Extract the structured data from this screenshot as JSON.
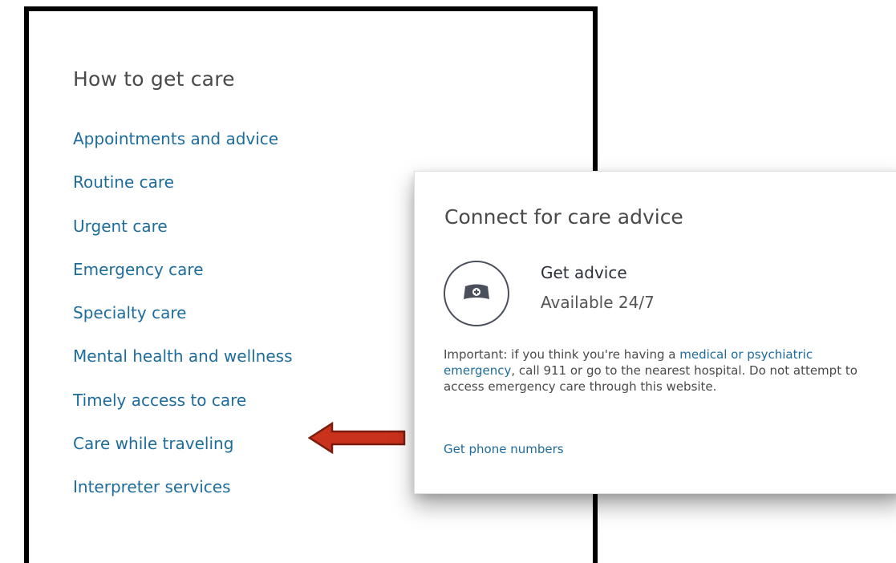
{
  "left_panel": {
    "title": "How to get care",
    "items": [
      {
        "label": "Appointments and advice"
      },
      {
        "label": "Routine care"
      },
      {
        "label": "Urgent care"
      },
      {
        "label": "Emergency care"
      },
      {
        "label": "Specialty care"
      },
      {
        "label": "Mental health and wellness"
      },
      {
        "label": "Timely access to care"
      },
      {
        "label": "Care while traveling"
      },
      {
        "label": "Interpreter services"
      }
    ]
  },
  "annotation": {
    "arrow_icon": "left-arrow-icon",
    "arrow_color": "#c9321c"
  },
  "popup": {
    "title": "Connect for care advice",
    "advice_icon": "nurse-cap-icon",
    "advice_heading": "Get advice",
    "advice_sub": "Available 24/7",
    "notice_before": "Important: if you think you're having a ",
    "notice_link": "medical or psychiatric emergency",
    "notice_after": ", call 911 or go to the nearest hospital. Do not attempt to access emergency care through this website.",
    "phone_link": "Get phone numbers"
  },
  "colors": {
    "link": "#1e6c9c",
    "heading": "#4a4a4a",
    "border": "#000000"
  }
}
